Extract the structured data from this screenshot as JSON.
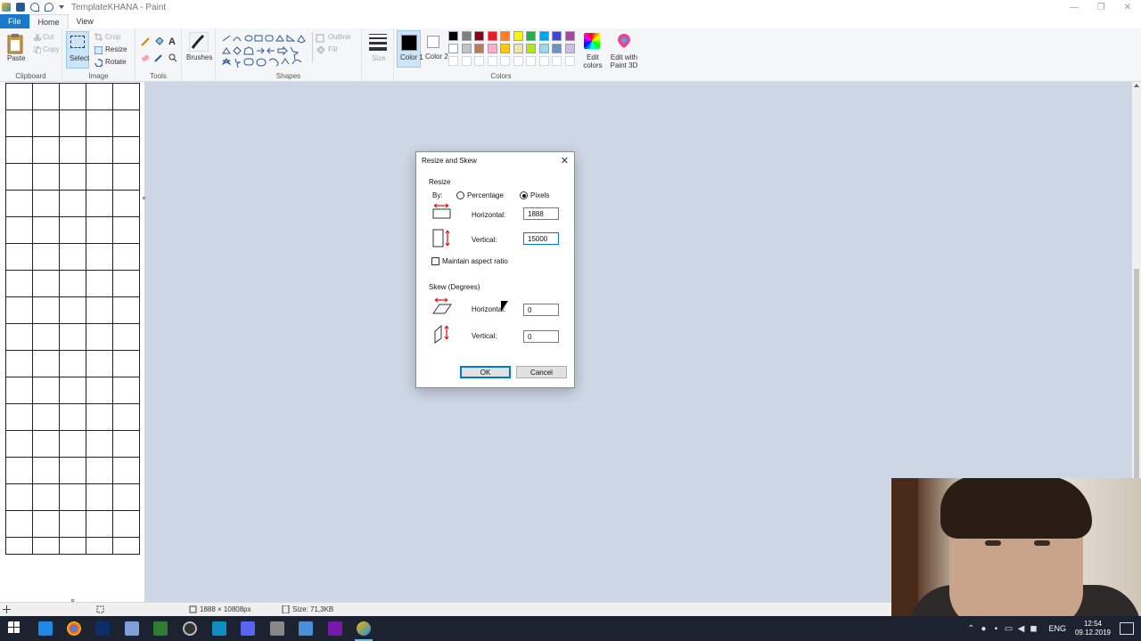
{
  "window": {
    "title": "TemplateKHANA - Paint",
    "minimize": "—",
    "maximize": "❐",
    "close": "✕"
  },
  "tabs": [
    "File",
    "Home",
    "View"
  ],
  "ribbon": {
    "clipboard": {
      "paste": "Paste",
      "cut": "Cut",
      "copy": "Copy",
      "label": "Clipboard"
    },
    "image": {
      "select": "Select",
      "crop": "Crop",
      "resize": "Resize",
      "rotate": "Rotate",
      "label": "Image"
    },
    "tools": {
      "label": "Tools"
    },
    "brushes": {
      "label": "Brushes"
    },
    "shapes": {
      "outline": "Outline",
      "fill": "Fill",
      "label": "Shapes"
    },
    "size": {
      "label": "Size"
    },
    "color1": {
      "label": "Color 1"
    },
    "color2": {
      "label": "Color 2"
    },
    "colors": {
      "label": "Colors"
    },
    "edit_colors": {
      "label": "Edit colors"
    },
    "edit_3d": {
      "label": "Edit with Paint 3D"
    }
  },
  "palette_row1": [
    "#000000",
    "#7f7f7f",
    "#880015",
    "#ed1c24",
    "#ff7f27",
    "#fff200",
    "#22b14c",
    "#00a2e8",
    "#3f48cc",
    "#a349a4"
  ],
  "palette_row2": [
    "#ffffff",
    "#c3c3c3",
    "#b97a57",
    "#ffaec9",
    "#ffc90e",
    "#efe4b0",
    "#b5e61d",
    "#99d9ea",
    "#7092be",
    "#c8bfe7"
  ],
  "dialog": {
    "title": "Resize and Skew",
    "close": "✕",
    "resize_section": "Resize",
    "by_label": "By:",
    "percentage": "Percentage",
    "pixels": "Pixels",
    "selected_unit": "Pixels",
    "horizontal_label": "Horizontal:",
    "horizontal_value": "1888",
    "vertical_label": "Vertical:",
    "vertical_value": "15000",
    "maintain_aspect": "Maintain aspect ratio",
    "maintain_checked": false,
    "skew_section": "Skew (Degrees)",
    "skew_horizontal_label": "Horizontal:",
    "skew_horizontal_value": "0",
    "skew_vertical_label": "Vertical:",
    "skew_vertical_value": "0",
    "ok": "OK",
    "cancel": "Cancel"
  },
  "status": {
    "dimensions": "1888 × 10808px",
    "size": "Size: 71,3KB"
  },
  "taskbar": {
    "language": "ENG",
    "time": "12:54",
    "date": "09.12.2019"
  }
}
